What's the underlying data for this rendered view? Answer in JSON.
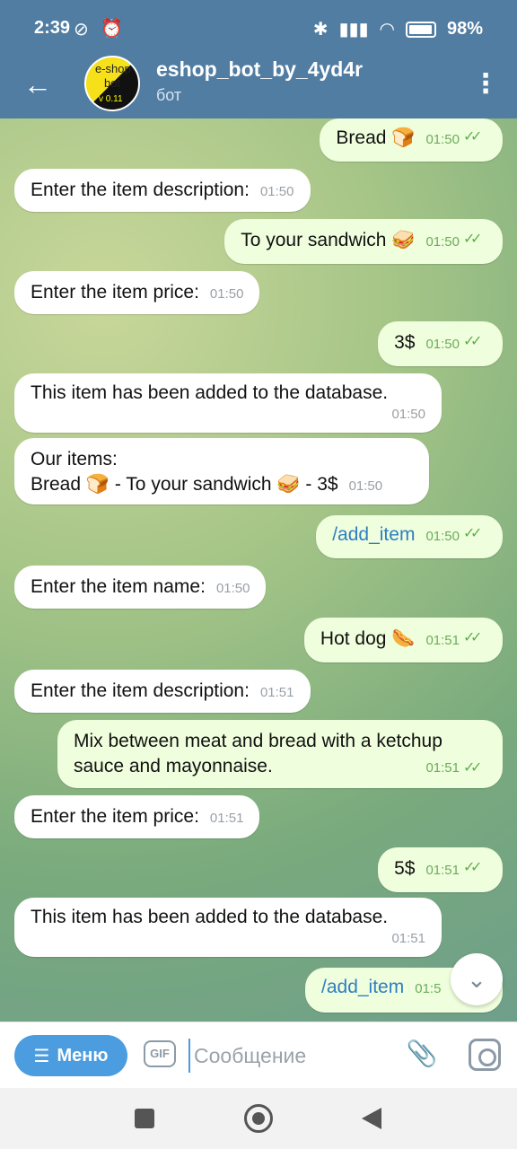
{
  "status_bar": {
    "time": "2:39",
    "battery": "98%"
  },
  "header": {
    "title": "eshop_bot_by_4yd4r",
    "subtitle": "бот",
    "avatar_lines": [
      "e-shop",
      "bot",
      "v 0.11"
    ]
  },
  "messages": [
    {
      "dir": "out",
      "text": "Bread 🍞",
      "time": "01:50"
    },
    {
      "dir": "in",
      "text": "Enter the item description:",
      "time": "01:50"
    },
    {
      "dir": "out",
      "text": "To your sandwich 🥪",
      "time": "01:50"
    },
    {
      "dir": "in",
      "text": "Enter the item price:",
      "time": "01:50"
    },
    {
      "dir": "out",
      "text": "3$",
      "time": "01:50"
    },
    {
      "dir": "in",
      "text": "This item has been added to the database.",
      "time": "01:50"
    },
    {
      "dir": "in",
      "text_line1": "Our items:",
      "text_line2": "Bread 🍞 - To your sandwich 🥪 - 3$",
      "time": "01:50"
    },
    {
      "dir": "out",
      "text": "/add_item",
      "time": "01:50"
    },
    {
      "dir": "in",
      "text": "Enter the item name:",
      "time": "01:50"
    },
    {
      "dir": "out",
      "text": "Hot dog 🌭",
      "time": "01:51"
    },
    {
      "dir": "in",
      "text": "Enter the item description:",
      "time": "01:51"
    },
    {
      "dir": "out",
      "text_line1": "Mix between meat and bread with a ketchup",
      "text_line2": "sauce and mayonnaise.",
      "time": "01:51"
    },
    {
      "dir": "in",
      "text": "Enter the item price:",
      "time": "01:51"
    },
    {
      "dir": "out",
      "text": "5$",
      "time": "01:51"
    },
    {
      "dir": "in",
      "text": "This item has been added to the database.",
      "time": "01:51"
    },
    {
      "dir": "out",
      "text": "/add_item",
      "time": "01:5"
    }
  ],
  "composer": {
    "menu_label": "Меню",
    "gif_label": "GIF",
    "placeholder": "Сообщение"
  },
  "colors": {
    "header": "#517da2",
    "outgoing": "#effedd",
    "incoming": "#ffffff",
    "accent": "#4c9ce0"
  }
}
